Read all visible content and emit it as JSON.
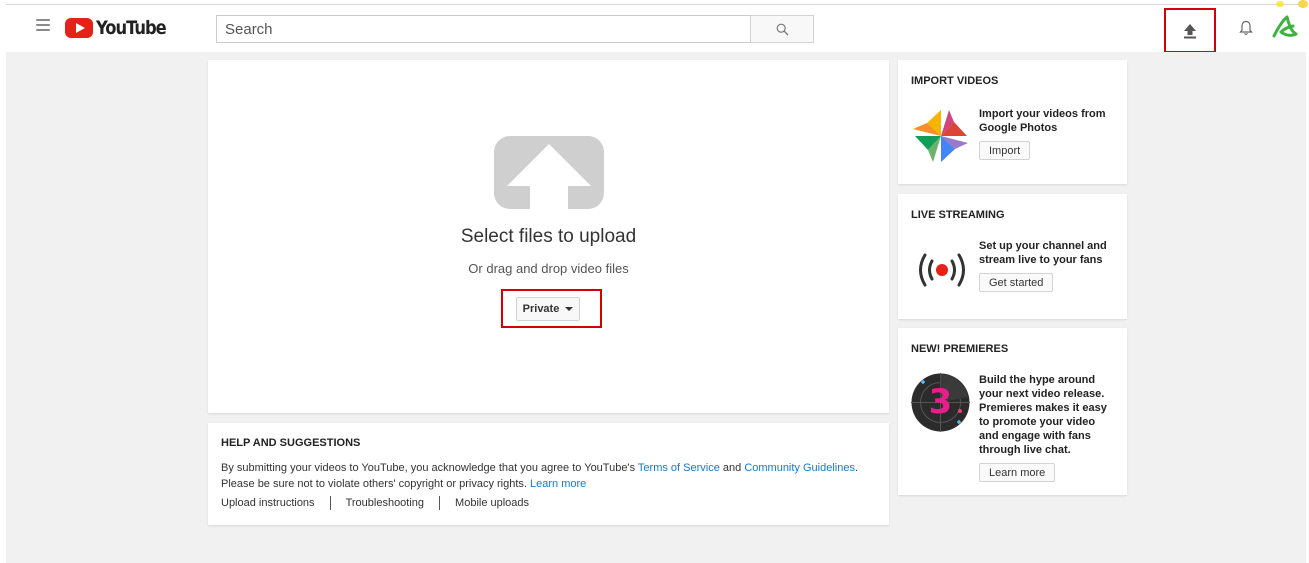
{
  "header": {
    "logo_text": "YouTube",
    "search": {
      "placeholder": "Search",
      "value": ""
    },
    "icons": {
      "menu": "hamburger-menu-icon",
      "search": "search-icon",
      "upload": "upload-arrow-icon",
      "notifications": "bell-icon",
      "account": "account-avatar-icon"
    }
  },
  "upload": {
    "title": "Select files to upload",
    "subtitle": "Or drag and drop video files",
    "privacy_selected": "Private"
  },
  "help": {
    "title": "HELP AND SUGGESTIONS",
    "text_part1": "By submitting your videos to YouTube, you acknowledge that you agree to YouTube's ",
    "terms_link": "Terms of Service",
    "text_and": " and ",
    "guidelines_link": "Community Guidelines",
    "text_part2": ".",
    "text_line2": "Please be sure not to violate others' copyright or privacy rights. ",
    "learn_more_link": "Learn more",
    "links": [
      "Upload instructions",
      "Troubleshooting",
      "Mobile uploads"
    ]
  },
  "sidebar": {
    "import": {
      "title": "IMPORT VIDEOS",
      "description": "Import your videos from Google Photos",
      "button": "Import"
    },
    "live": {
      "title": "LIVE STREAMING",
      "description": "Set up your channel and stream live to your fans",
      "button": "Get started"
    },
    "premieres": {
      "title": "NEW! PREMIERES",
      "description": "Build the hype around your next video release. Premieres makes it easy to promote your video and engage with fans through live chat.",
      "button": "Learn more",
      "badge_number": "3"
    }
  },
  "colors": {
    "brand_red": "#e62117",
    "link_blue": "#167ac6",
    "highlight_red": "#d50000",
    "page_bg": "#f1f1f1"
  }
}
